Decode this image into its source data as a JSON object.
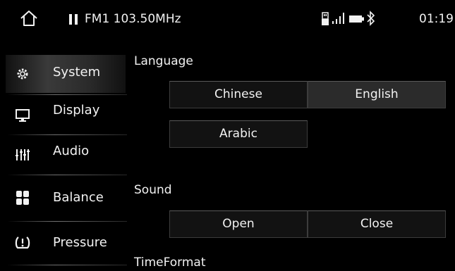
{
  "status_bar": {
    "source": "FM1",
    "frequency": "103.50MHz",
    "time": "01:19",
    "icons": [
      "home-icon",
      "pause-icon",
      "usb-icon",
      "signal-icon",
      "battery-icon",
      "bluetooth-icon"
    ]
  },
  "sidebar": {
    "items": [
      {
        "label": "System",
        "icon": "gear-icon",
        "selected": true
      },
      {
        "label": "Display",
        "icon": "monitor-icon",
        "selected": false
      },
      {
        "label": "Audio",
        "icon": "equalizer-icon",
        "selected": false
      },
      {
        "label": "Balance",
        "icon": "balance-icon",
        "selected": false
      },
      {
        "label": "Pressure",
        "icon": "tire-pressure-icon",
        "selected": false
      }
    ]
  },
  "settings": {
    "language": {
      "title": "Language",
      "options": [
        "Chinese",
        "English",
        "Arabic"
      ],
      "selected": "English"
    },
    "sound": {
      "title": "Sound",
      "options": [
        "Open",
        "Close"
      ]
    },
    "time_format": {
      "title": "TimeFormat"
    }
  },
  "colors": {
    "background": "#000000",
    "text": "#f2f2f2",
    "button": "#121212",
    "button_active": "#2b2b2b",
    "button_border": "#3c3c3c"
  }
}
